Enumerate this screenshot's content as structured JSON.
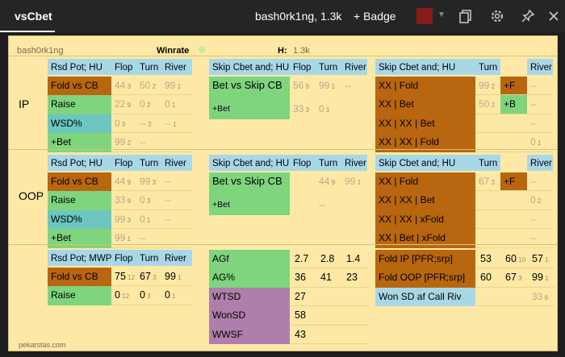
{
  "window": {
    "tab_title": "vsCbet",
    "player": "bash0rk1ng, 1.3k",
    "badge_button": "+ Badge"
  },
  "colors": {
    "badge_color": "#8b1a1a",
    "orange": "#b8660f",
    "green": "#7ed57e",
    "teal": "#6cc6c0",
    "mauve": "#b07eaa",
    "header": "#a8d8e8",
    "panel": "#fde9a5"
  },
  "panel": {
    "player_name": "bash0rk1ng",
    "winrate_label": "Winrate",
    "h_label": "H:",
    "h_value": "1.3k",
    "footer": "pekarstas.com"
  },
  "ip": {
    "label": "IP",
    "rsd": {
      "header": "Rsd Pot; HU",
      "c1": "Flop",
      "c2": "Turn",
      "c3": "River",
      "rows": [
        {
          "label": "Fold vs CB",
          "v1": "44",
          "s1": "3",
          "v2": "50",
          "s2": "2",
          "v3": "99",
          "s3": "1"
        },
        {
          "label": "Raise",
          "v1": "22",
          "s1": "9",
          "v2": "0",
          "s2": "2",
          "v3": "0",
          "s3": "1"
        },
        {
          "label": "WSD%",
          "v1": "0",
          "s1": "3",
          "v2": "--",
          "s2": "2",
          "v3": "--",
          "s3": "1"
        },
        {
          "label": "+Bet",
          "v1": "99",
          "s1": "2",
          "v2": "--",
          "s2": "",
          "v3": "",
          "s3": ""
        }
      ]
    },
    "skipcbet": {
      "header": "Skip Cbet and; HU",
      "c1": "Flop",
      "c2": "Turn",
      "c3": "River",
      "rows": [
        {
          "label": "Bet vs Skip CB",
          "v1": "56",
          "s1": "9",
          "v2": "99",
          "s2": "1",
          "v3": "--",
          "s3": ""
        },
        {
          "label": "+Bet",
          "v1": "33",
          "s1": "3",
          "v2": "0",
          "s2": "1",
          "v3": "",
          "s3": ""
        }
      ]
    },
    "skipcbet2": {
      "header": "Skip Cbet and; HU",
      "c1": "Turn",
      "c2": "River",
      "rows": [
        {
          "label": "XX | Fold",
          "v1": "99",
          "s1": "2",
          "mark": "+F",
          "v2": "--"
        },
        {
          "label": "XX | Bet",
          "v1": "50",
          "s1": "2",
          "mark": "+B",
          "v2": "--"
        },
        {
          "label": "XX | XX | Bet",
          "v1": "",
          "s1": "",
          "mark": "",
          "v2": "--"
        },
        {
          "label": "XX | XX | Fold",
          "v1": "",
          "s1": "",
          "mark": "",
          "v2": "0",
          "s2": "1"
        }
      ]
    }
  },
  "oop": {
    "label": "OOP",
    "rsd": {
      "header": "Rsd Pot; HU",
      "c1": "Flop",
      "c2": "Turn",
      "c3": "River",
      "rows": [
        {
          "label": "Fold vs CB",
          "v1": "44",
          "s1": "9",
          "v2": "99",
          "s2": "3",
          "v3": "--",
          "s3": ""
        },
        {
          "label": "Raise",
          "v1": "33",
          "s1": "9",
          "v2": "0",
          "s2": "3",
          "v3": "--",
          "s3": ""
        },
        {
          "label": "WSD%",
          "v1": "99",
          "s1": "3",
          "v2": "0",
          "s2": "1",
          "v3": "--",
          "s3": ""
        },
        {
          "label": "+Bet",
          "v1": "99",
          "s1": "1",
          "v2": "--",
          "s2": "",
          "v3": "",
          "s3": ""
        }
      ]
    },
    "skipcbet": {
      "header": "Skip Cbet and; HU",
      "c1": "Flop",
      "c2": "Turn",
      "c3": "River",
      "rows": [
        {
          "label": "Bet vs Skip CB",
          "v1": "",
          "s1": "",
          "v2": "44",
          "s2": "9",
          "v3": "99",
          "s3": "1"
        },
        {
          "label": "+Bet",
          "v1": "",
          "s1": "",
          "v2": "--",
          "s2": "",
          "v3": "",
          "s3": ""
        }
      ]
    },
    "skipcbet2": {
      "header": "Skip Cbet and; HU",
      "c1": "Turn",
      "c2": "River",
      "rows": [
        {
          "label": "XX | Fold",
          "v1": "67",
          "s1": "3",
          "mark": "+F",
          "v2": "--"
        },
        {
          "label": "XX | XX | Bet",
          "v1": "",
          "s1": "",
          "mark": "",
          "v2": "0",
          "s2": "2"
        },
        {
          "label": "XX | XX | xFold",
          "v1": "",
          "s1": "",
          "mark": "",
          "v2": "--"
        },
        {
          "label": "XX | Bet | xFold",
          "v1": "",
          "s1": "",
          "mark": "",
          "v2": "--"
        }
      ]
    }
  },
  "mwp": {
    "header": "Rsd Pot; MWP",
    "c1": "Flop",
    "c2": "Turn",
    "c3": "River",
    "rows": [
      {
        "label": "Fold vs CB",
        "v1": "75",
        "s1": "12",
        "v2": "67",
        "s2": "3",
        "v3": "99",
        "s3": "1"
      },
      {
        "label": "Raise",
        "v1": "0",
        "s1": "12",
        "v2": "0",
        "s2": "3",
        "v3": "0",
        "s3": "1"
      }
    ]
  },
  "agg": {
    "rows": [
      {
        "label": "AGf",
        "v1": "2.7",
        "v2": "2.8",
        "v3": "1.4"
      },
      {
        "label": "AG%",
        "v1": "36",
        "v2": "41",
        "v3": "23"
      }
    ],
    "sd": [
      {
        "label": "WTSD",
        "value": "27"
      },
      {
        "label": "WonSD",
        "value": "58"
      },
      {
        "label": "WWSF",
        "value": "43"
      }
    ]
  },
  "fold": {
    "rows": [
      {
        "label": "Fold IP [PFR;srp]",
        "v1": "53",
        "v2": "60",
        "s2": "10",
        "v3": "57",
        "s3": "1"
      },
      {
        "label": "Fold OOP [PFR;srp]",
        "v1": "60",
        "v2": "67",
        "s2": "3",
        "v3": "99",
        "s3": "1"
      },
      {
        "label": "Won SD af Call Riv",
        "v1": "",
        "v2": "",
        "s2": "",
        "v3": "33",
        "s3": "6"
      }
    ]
  }
}
